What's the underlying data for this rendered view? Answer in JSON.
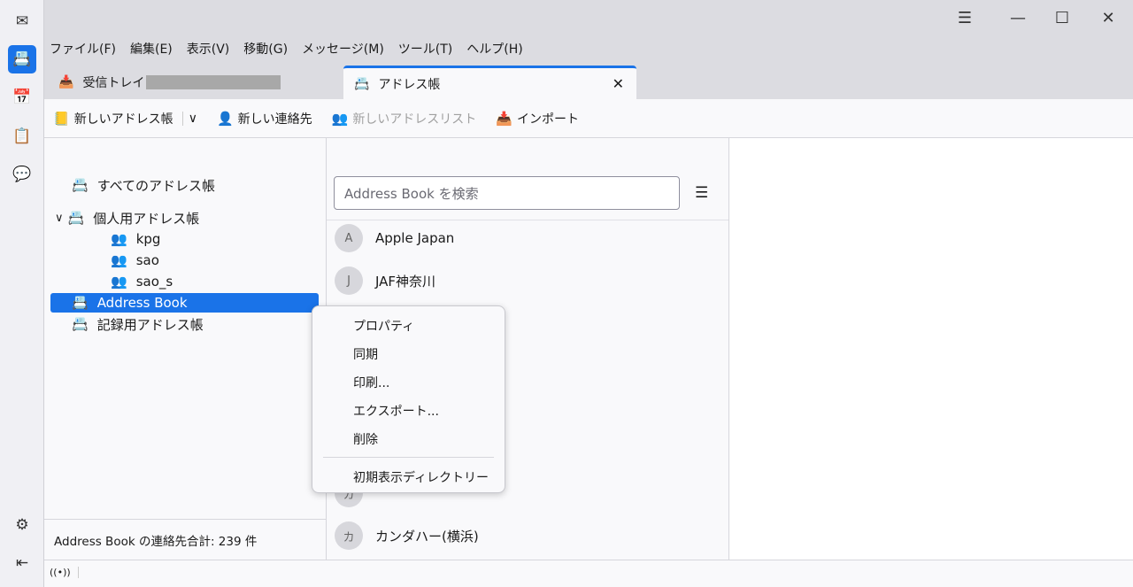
{
  "spaces": {
    "items": [
      {
        "name": "mail",
        "icon": "✉"
      },
      {
        "name": "address-book",
        "icon": "📇",
        "active": true
      },
      {
        "name": "calendar",
        "icon": "📅"
      },
      {
        "name": "tasks",
        "icon": "📋"
      },
      {
        "name": "chat",
        "icon": "💬"
      }
    ],
    "settings_icon": "⚙",
    "collapse_icon": "⇤"
  },
  "window": {
    "menu_icon": "☰",
    "minimize": "—",
    "maximize": "☐",
    "close": "✕"
  },
  "menubar": [
    "ファイル(F)",
    "編集(E)",
    "表示(V)",
    "移動(G)",
    "メッセージ(M)",
    "ツール(T)",
    "ヘルプ(H)"
  ],
  "tabs": [
    {
      "label": "受信トレイ",
      "icon": "📥"
    },
    {
      "label": "アドレス帳",
      "icon": "📇",
      "close": "✕"
    }
  ],
  "toolbar": {
    "new_book": "新しいアドレス帳",
    "dropdown": "∨",
    "new_contact": "新しい連絡先",
    "new_list": "新しいアドレスリスト",
    "import": "インポート"
  },
  "tree": {
    "all": "すべてのアドレス帳",
    "personal": "個人用アドレス帳",
    "children": [
      "kpg",
      "sao",
      "sao_s"
    ],
    "selected": "Address Book",
    "record": "記録用アドレス帳",
    "expand": "∨"
  },
  "footer": "Address Book の連絡先合計: 239 件",
  "search": {
    "placeholder": "Address Book を検索"
  },
  "contacts": [
    {
      "initial": "A",
      "name": "Apple Japan"
    },
    {
      "initial": "J",
      "name": "JAF神奈川"
    },
    {
      "initial": "カ",
      "name": ""
    },
    {
      "initial": "カ",
      "name": "カンダハー(横浜)"
    }
  ],
  "context_menu": [
    "プロパティ",
    "同期",
    "印刷...",
    "エクスポート...",
    "削除",
    "初期表示ディレクトリー"
  ],
  "accent": "#1a73e8",
  "status_icon": "((•))"
}
